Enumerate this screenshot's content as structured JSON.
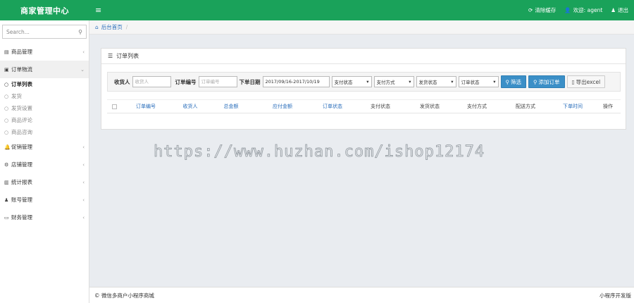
{
  "topbar": {
    "brand": "商家管理中心",
    "menu_icon": "hamburger-icon",
    "clear_cache": "清除缓存",
    "welcome": "欢迎: agent",
    "logout": "退出",
    "color": "#1aa25a"
  },
  "sidebar": {
    "search_placeholder": "Search...",
    "items": [
      {
        "label": "商品管理",
        "icon": "list-icon"
      },
      {
        "label": "订单物流",
        "icon": "truck-icon"
      },
      {
        "label": "促销管理",
        "icon": "bell-icon"
      },
      {
        "label": "店铺管理",
        "icon": "gear-icon"
      },
      {
        "label": "统计报表",
        "icon": "bar-chart-icon"
      },
      {
        "label": "账号管理",
        "icon": "user-icon"
      },
      {
        "label": "财务管理",
        "icon": "card-icon"
      }
    ],
    "subitems": [
      "订单列表",
      "发货",
      "发货设置",
      "商品评论",
      "商品咨询"
    ]
  },
  "breadcrumb": {
    "home": "后台首页",
    "sep": "/"
  },
  "panel": {
    "title": "订单列表",
    "filters": {
      "consignee_label": "收货人",
      "consignee_placeholder": "收货人",
      "order_no_label": "订单编号",
      "order_no_placeholder": "订单编号",
      "date_label": "下单日期",
      "date_value": "2017/09/16-2017/10/19",
      "selects": [
        "支付状态",
        "支付方式",
        "发货状态",
        "订单状态"
      ],
      "filter_btn": "筛选",
      "add_btn": "添加订单",
      "export_btn": "导出excel"
    },
    "columns": [
      "订单编号",
      "收货人",
      "总金额",
      "应付金额",
      "订单状态",
      "支付状态",
      "发货状态",
      "支付方式",
      "配送方式",
      "下单时间",
      "操作"
    ]
  },
  "watermark": "https://www.huzhan.com/ishop12174",
  "footer": {
    "left": "© 微信多商户小程序商城",
    "right": "小程序开发版"
  }
}
